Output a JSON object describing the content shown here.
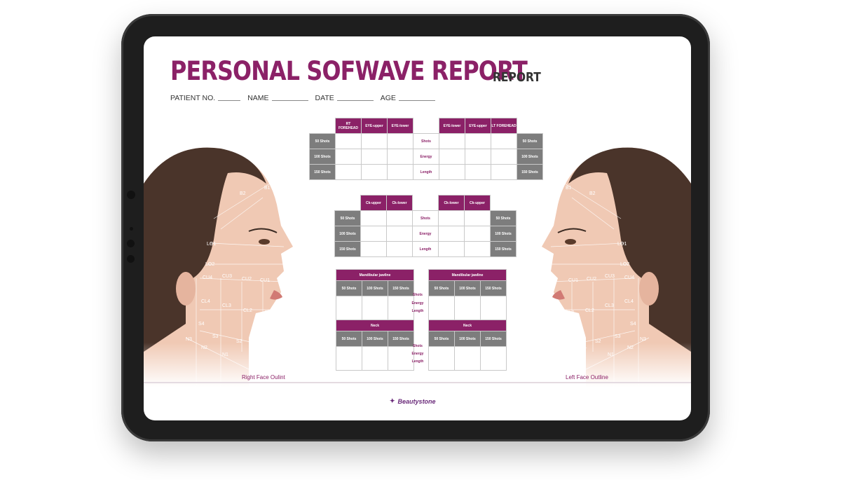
{
  "report": {
    "title": "PERSONAL SOFWAVE REPORT",
    "subtitle": "REPORT",
    "fields": [
      "PATIENT NO.",
      "NAME",
      "DATE",
      "AGE"
    ]
  },
  "table1": {
    "headers_left": [
      "RT FOREHEAD",
      "EYE-upper",
      "EYE-lower"
    ],
    "headers_right": [
      "EYE-lower",
      "EYE-upper",
      "LT FOREHEAD"
    ],
    "rows": [
      "50 Shots",
      "100 Shots",
      "150 Shots"
    ],
    "center": [
      "Shots",
      "Energy",
      "Length"
    ]
  },
  "table2": {
    "headers_left": [
      "Ck-upper",
      "Ck-lower"
    ],
    "headers_right": [
      "Ck-lower",
      "Ck-upper"
    ],
    "rows": [
      "50 Shots",
      "100 Shots",
      "150 Shots"
    ],
    "center": [
      "Shots",
      "Energy",
      "Length"
    ]
  },
  "table3": {
    "title_left": "Mandibular jawline",
    "title_right": "Mandibular jawline",
    "cols": [
      "50 Shots",
      "100 Shots",
      "150 Shots"
    ],
    "center": [
      "Shots",
      "Energy",
      "Length"
    ]
  },
  "table4": {
    "title_left": "Neck",
    "title_right": "Neck",
    "cols": [
      "50 Shots",
      "100 Shots",
      "150 Shots"
    ],
    "center": [
      "Shots",
      "Energy",
      "Length"
    ]
  },
  "faces": {
    "right_caption": "Right Face Oulint",
    "left_caption": "Left Face Outline",
    "right_labels": [
      "B1",
      "B2",
      "LO1",
      "LO2",
      "CU4",
      "CU3",
      "CU2",
      "CU1",
      "CL4",
      "CL3",
      "CL2",
      "CL1",
      "S4",
      "S3",
      "S2",
      "S1",
      "N3",
      "N2",
      "N1"
    ],
    "left_labels": [
      "B1",
      "B2",
      "LO1",
      "LO2",
      "CU1",
      "CU2",
      "CU3",
      "CU4",
      "CL1",
      "CL2",
      "CL3",
      "CL4",
      "S1",
      "S3",
      "S4",
      "N1",
      "N2",
      "N3",
      "S2"
    ]
  },
  "brand": "Beautystone",
  "colors": {
    "accent": "#8b2167",
    "gray": "#7d7d7d",
    "frame": "#1e1e1e"
  }
}
